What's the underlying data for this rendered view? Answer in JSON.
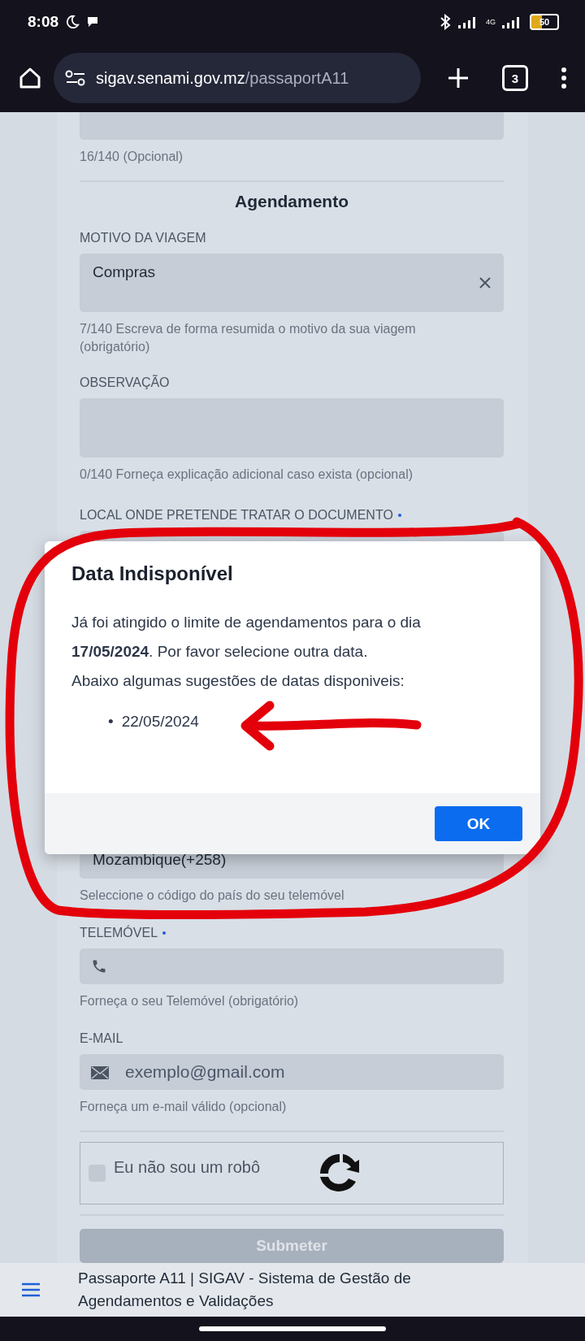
{
  "status_bar": {
    "time": "8:08",
    "network": "4G",
    "battery": "50"
  },
  "browser": {
    "url_host": "sigav.senami.gov.mz",
    "url_path": "/passaportA11",
    "tab_count": "3"
  },
  "sections": [
    {
      "kind": "hint_only",
      "hint": "16/140 (Opcional)"
    },
    {
      "kind": "heading",
      "text": "Agendamento"
    },
    {
      "kind": "textarea",
      "label": "MOTIVO DA VIAGEM",
      "required": false,
      "value": "Compras",
      "clearable": true,
      "hint": "7/140 Escreva de forma resumida o motivo da sua viagem (obrigatório)"
    },
    {
      "kind": "textarea",
      "label": "OBSERVAÇÃO",
      "required": false,
      "hint": "0/140 Forneça explicação adicional caso exista (opcional)"
    },
    {
      "kind": "covered",
      "label": "LOCAL ONDE PRETENDE TRATAR O DOCUMENTO",
      "required": true
    },
    {
      "kind": "select_tail",
      "value": "Mozambique(+258)",
      "hint": "Seleccione o código do país do seu telemóvel"
    },
    {
      "kind": "phone",
      "label": "TELEMÓVEL",
      "required": true,
      "hint": "Forneça o seu Telemóvel (obrigatório)"
    },
    {
      "kind": "email",
      "label": "E-MAIL",
      "required": false,
      "placeholder": "exemplo@gmail.com",
      "hint": "Forneça um e-mail válido (opcional)"
    },
    {
      "kind": "captcha",
      "label": "Eu não sou um robô",
      "checked": false
    },
    {
      "kind": "submit",
      "label": "Submeter",
      "disabled": true
    }
  ],
  "dialog": {
    "title": "Data Indisponível",
    "message": "Já foi atingido o limite de agendamentos para o dia **17/05/2024**. Por favor selecione outra data.",
    "note": "Abaixo algumas sugestões de datas disponiveis:",
    "bullet": "•",
    "suggestions": [
      "22/05/2024"
    ],
    "button": "OK"
  },
  "footer": {
    "text": "Passaporte A11 | SIGAV - Sistema de Gestão de Agendamentos e Validações"
  }
}
